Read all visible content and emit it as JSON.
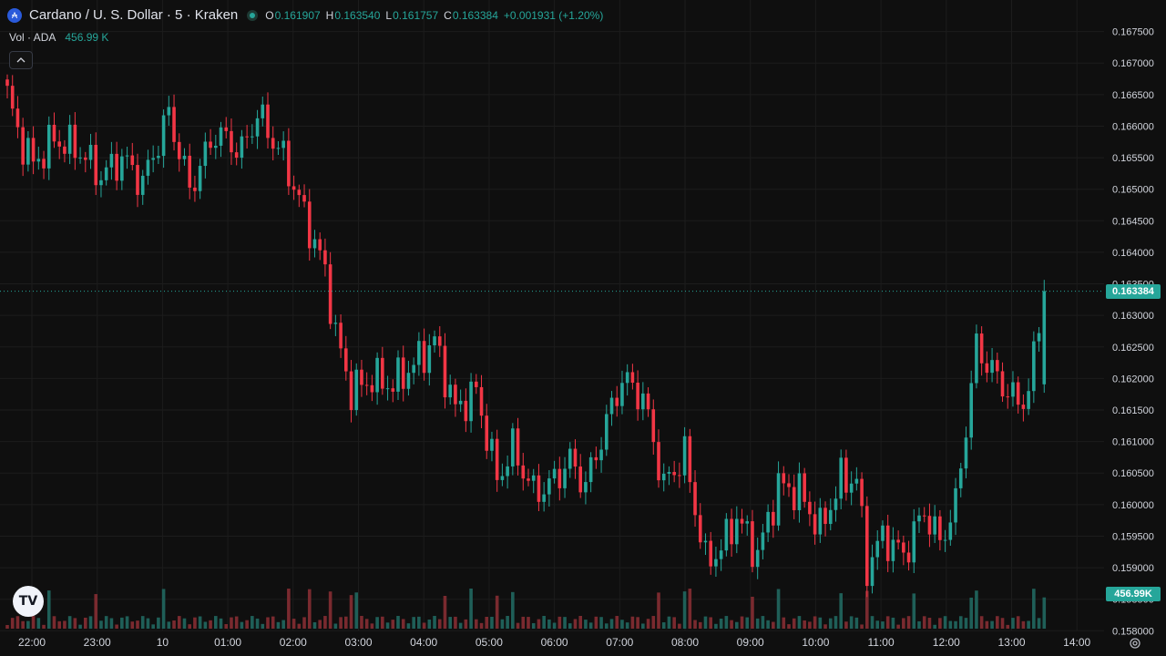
{
  "header": {
    "symbol_icon": "cardano-coin-icon",
    "title": "Cardano / U. S. Dollar · 5 · Kraken",
    "open_label": "O",
    "open": "0.161907",
    "high_label": "H",
    "high": "0.163540",
    "low_label": "L",
    "low": "0.161757",
    "close_label": "C",
    "close": "0.163384",
    "change": "+0.001931 (+1.20%)"
  },
  "volume_legend": {
    "label": "Vol · ADA",
    "value": "456.99 K"
  },
  "collapse_icon": "chevron-up-icon",
  "logo_text": "TV",
  "settings_icon": "gear-icon",
  "colors": {
    "up": "#26a69a",
    "down": "#f23645",
    "background": "#0f0f0f",
    "grid": "#1c1c1c",
    "axis_text": "#d1d4dc"
  },
  "chart_data": {
    "type": "candlestick",
    "interval": "5",
    "x_tick_labels": [
      "22:00",
      "23:00",
      "10",
      "01:00",
      "02:00",
      "03:00",
      "04:00",
      "05:00",
      "06:00",
      "07:00",
      "08:00",
      "09:00",
      "10:00",
      "11:00",
      "12:00",
      "13:00",
      "14:00"
    ],
    "y_tick_labels": [
      "0.158000",
      "0.158500",
      "0.159000",
      "0.159500",
      "0.160000",
      "0.160500",
      "0.161000",
      "0.161500",
      "0.162000",
      "0.162500",
      "0.163000",
      "0.163500",
      "0.164000",
      "0.164500",
      "0.165000",
      "0.165500",
      "0.166000",
      "0.166500",
      "0.167000",
      "0.167500"
    ],
    "ylim": [
      0.1576,
      0.168
    ],
    "last_price": "0.163384",
    "last_volume": "456.99K",
    "anchor_points": [
      [
        0,
        0.1665
      ],
      [
        2,
        0.1659
      ],
      [
        5,
        0.1654
      ],
      [
        9,
        0.1658
      ],
      [
        14,
        0.1656
      ],
      [
        18,
        0.1652
      ],
      [
        22,
        0.1655
      ],
      [
        26,
        0.1651
      ],
      [
        31,
        0.1662
      ],
      [
        35,
        0.165
      ],
      [
        40,
        0.1659
      ],
      [
        45,
        0.1656
      ],
      [
        48,
        0.1662
      ],
      [
        53,
        0.1655
      ],
      [
        57,
        0.1646
      ],
      [
        61,
        0.1637
      ],
      [
        63,
        0.1627
      ],
      [
        66,
        0.1618
      ],
      [
        70,
        0.162
      ],
      [
        74,
        0.1619
      ],
      [
        79,
        0.1623
      ],
      [
        82,
        0.1626
      ],
      [
        86,
        0.1615
      ],
      [
        90,
        0.1618
      ],
      [
        94,
        0.1604
      ],
      [
        97,
        0.1609
      ],
      [
        101,
        0.1602
      ],
      [
        104,
        0.1603
      ],
      [
        108,
        0.1607
      ],
      [
        111,
        0.1603
      ],
      [
        115,
        0.1613
      ],
      [
        118,
        0.162
      ],
      [
        122,
        0.1617
      ],
      [
        126,
        0.1603
      ],
      [
        130,
        0.1608
      ],
      [
        134,
        0.1591
      ],
      [
        137,
        0.1593
      ],
      [
        140,
        0.1598
      ],
      [
        144,
        0.1592
      ],
      [
        148,
        0.1603
      ],
      [
        152,
        0.1602
      ],
      [
        156,
        0.1596
      ],
      [
        160,
        0.1604
      ],
      [
        163,
        0.1604
      ],
      [
        165,
        0.159
      ],
      [
        168,
        0.1595
      ],
      [
        172,
        0.1592
      ],
      [
        176,
        0.1599
      ],
      [
        179,
        0.1594
      ],
      [
        182,
        0.16
      ],
      [
        186,
        0.1625
      ],
      [
        190,
        0.162
      ],
      [
        194,
        0.1616
      ],
      [
        196,
        0.1618
      ],
      [
        199,
        0.1634
      ]
    ]
  }
}
